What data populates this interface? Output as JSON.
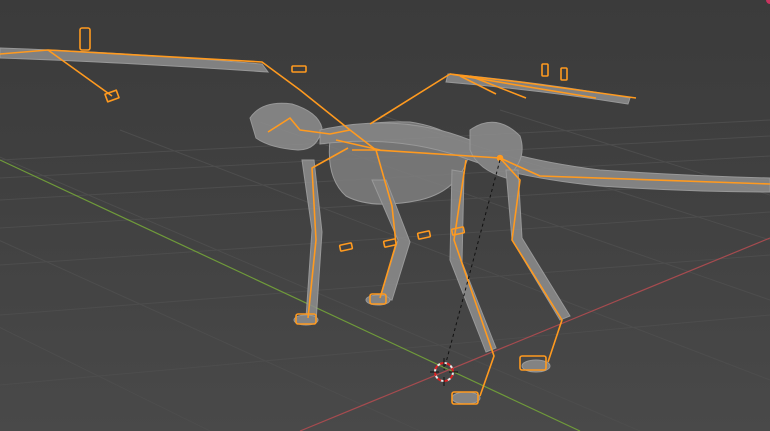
{
  "viewport": {
    "background_top": "#3d3d3d",
    "background_bottom": "#454545",
    "grid_color": "#4b4b4b",
    "x_axis_color": "#a64b4f",
    "y_axis_color": "#6f9a3a",
    "armature_selected_color": "#ff9a1f",
    "mesh_color": "#9a9a9a",
    "corner_indicator_color": "#c8345f"
  },
  "scene_objects": {
    "armature": {
      "state": "selected",
      "mode": "object"
    },
    "skeleton_mesh": {
      "shading": "solid"
    },
    "cursor_3d": {
      "icon": "crosshair-icon"
    }
  }
}
